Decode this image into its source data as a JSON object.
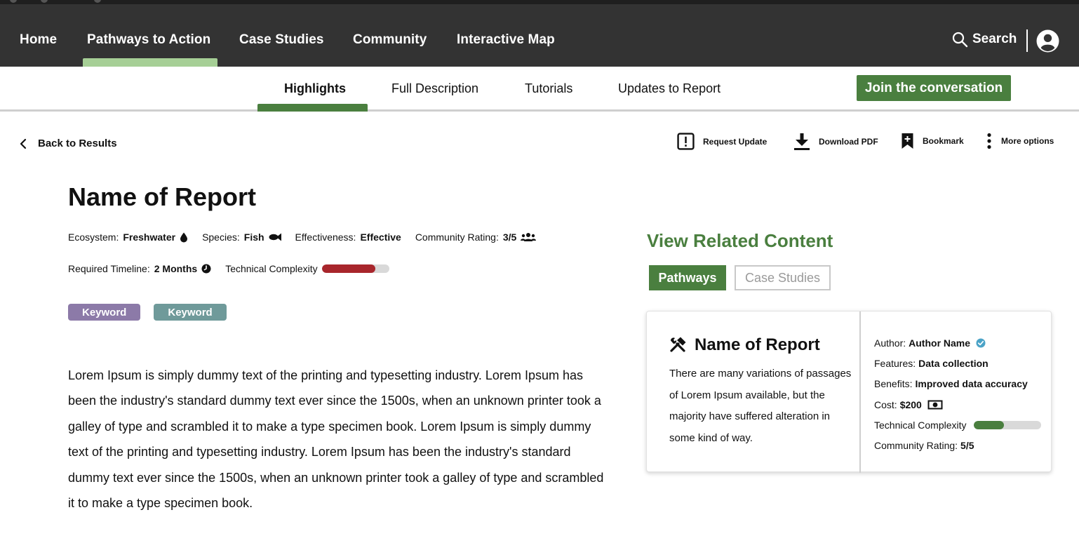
{
  "nav": {
    "items": [
      "Home",
      "Pathways to Action",
      "Case Studies",
      "Community",
      "Interactive Map"
    ],
    "active_index": 1,
    "search_label": "Search",
    "indicator_color": "#a6cf96",
    "bg_color": "#333333"
  },
  "subnav": {
    "tabs": [
      "Highlights",
      "Full Description",
      "Tutorials",
      "Updates to Report"
    ],
    "active_index": 0,
    "join_label": "Join the conversation"
  },
  "actions": {
    "back_label": "Back to Results",
    "request_update": "Request Update",
    "download_pdf": "Download PDF",
    "bookmark": "Bookmark",
    "more_options": "More options"
  },
  "report": {
    "title": "Name of Report",
    "ecosystem_label": "Ecosystem:",
    "ecosystem_value": "Freshwater",
    "species_label": "Species:",
    "species_value": "Fish",
    "effectiveness_label": "Effectiveness:",
    "effectiveness_value": "Effective",
    "rating_label": "Community Rating:",
    "rating_value": "3/5",
    "timeline_label": "Required Timeline:",
    "timeline_value": "2 Months",
    "complexity_label": "Technical Complexity",
    "complexity_level": 0.8,
    "complexity_color": "#a8262c",
    "keywords": [
      {
        "label": "Keyword",
        "color": "#8c7aa8"
      },
      {
        "label": "Keyword",
        "color": "#6f9a9a"
      }
    ],
    "body": "Lorem Ipsum is simply dummy text of the printing and typesetting industry. Lorem Ipsum has been the industry's standard dummy text ever since the 1500s, when an unknown printer took a galley of type and scrambled it to make a type specimen book. Lorem Ipsum is simply dummy text of the printing and typesetting industry. Lorem Ipsum has been the industry's standard dummy text ever since the 1500s, when an unknown printer took a galley of type and scrambled it to make a type specimen book."
  },
  "related": {
    "title": "View Related Content",
    "tab_pathways": "Pathways",
    "tab_case_studies": "Case Studies",
    "accent_color": "#4a7f3f",
    "card": {
      "title": "Name of Report",
      "description": "There are many variations of passages of Lorem Ipsum available, but the majority have suffered alteration in some kind of way.",
      "author_label": "Author:",
      "author_value": "Author Name",
      "features_label": "Features:",
      "features_value": "Data collection",
      "benefits_label": "Benefits:",
      "benefits_value": "Improved data accuracy",
      "cost_label": "Cost:",
      "cost_value": "$200",
      "complexity_label": "Technical Complexity",
      "complexity_level": 0.45,
      "complexity_color": "#4a7f3f",
      "rating_label": "Community Rating:",
      "rating_value": "5/5"
    }
  }
}
